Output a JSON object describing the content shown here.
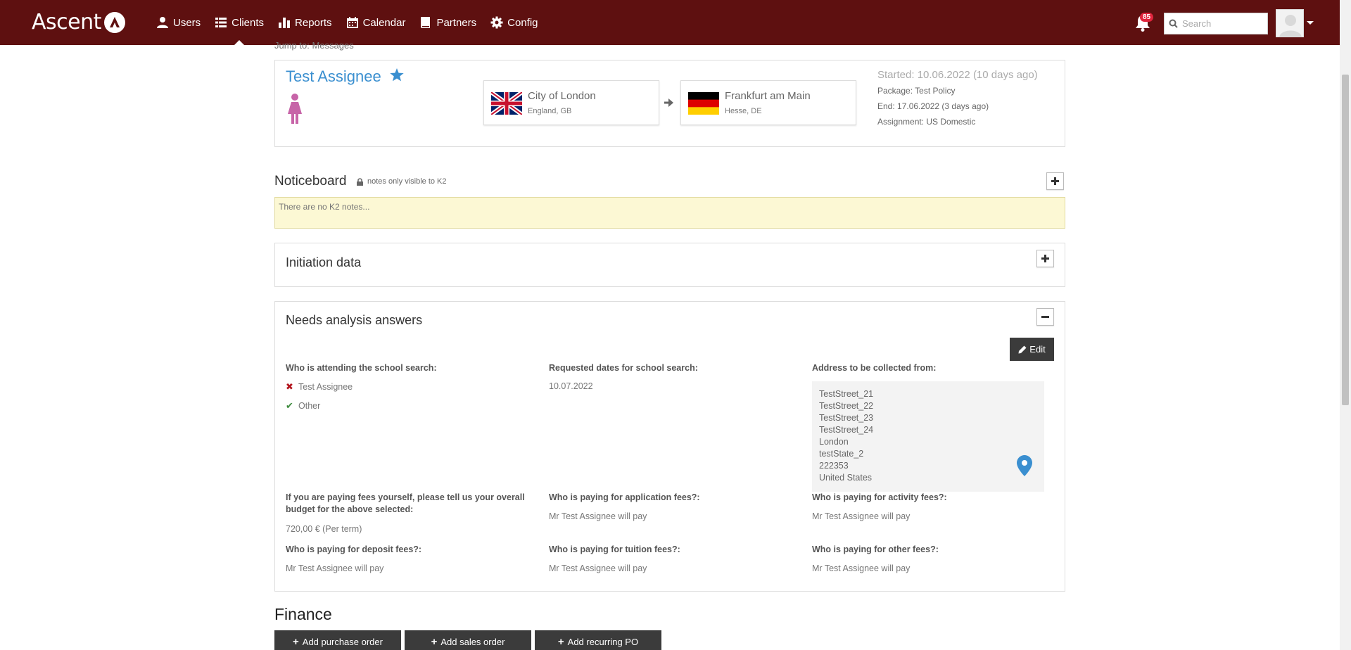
{
  "app": {
    "logo_text": "Ascent"
  },
  "nav": {
    "items": [
      {
        "label": "Users",
        "icon": "user-icon"
      },
      {
        "label": "Clients",
        "icon": "list-icon",
        "active": true
      },
      {
        "label": "Reports",
        "icon": "bar-chart-icon"
      },
      {
        "label": "Calendar",
        "icon": "calendar-icon"
      },
      {
        "label": "Partners",
        "icon": "book-icon"
      },
      {
        "label": "Config",
        "icon": "gear-icon"
      }
    ],
    "notification_count": "85",
    "search_placeholder": "Search"
  },
  "jump_to": "Jump to: Messages",
  "assignee": {
    "name": "Test Assignee",
    "origin": {
      "city": "City of London",
      "region": "England, GB"
    },
    "destination": {
      "city": "Frankfurt am Main",
      "region": "Hesse, DE"
    },
    "started": "Started: 10.06.2022 (10 days ago)",
    "package": "Package:  Test Policy",
    "end": "End:  17.06.2022 (3 days ago)",
    "assignment": "Assignment:  US Domestic"
  },
  "noticeboard": {
    "title": "Noticeboard",
    "visibility_note": "notes only visible to K2",
    "placeholder": "There are no K2 notes..."
  },
  "initiation": {
    "title": "Initiation data"
  },
  "needs": {
    "title": "Needs analysis answers",
    "edit_label": "Edit",
    "attending_label": "Who is attending the school search:",
    "attendees": [
      {
        "name": "Test Assignee",
        "selected": false
      },
      {
        "name": "Other",
        "selected": true
      }
    ],
    "dates_label": "Requested dates for school search:",
    "dates_value": "10.07.2022",
    "address_label": "Address to be collected from:",
    "address_lines": [
      "TestStreet_21",
      "TestStreet_22",
      "TestStreet_23",
      "TestStreet_24",
      "London",
      "testState_2",
      "222353",
      "United States"
    ],
    "budget_label": "If you are paying fees yourself, please tell us your overall budget for the above selected:",
    "budget_value": "720,00 € (Per term)",
    "application_label": "Who is paying for application fees?:",
    "application_value": "Mr Test Assignee will pay",
    "activity_label": "Who is paying for activity fees?:",
    "activity_value": "Mr Test Assignee will pay",
    "deposit_label": "Who is paying for deposit fees?:",
    "deposit_value": "Mr Test Assignee will pay",
    "tuition_label": "Who is paying for tuition fees?:",
    "tuition_value": "Mr Test Assignee will pay",
    "other_label": "Who is paying for other fees?:",
    "other_value": "Mr Test Assignee will pay"
  },
  "finance": {
    "title": "Finance",
    "buttons": [
      "Add purchase order",
      "Add sales order",
      "Add recurring PO"
    ]
  },
  "colors": {
    "navbar": "#5e1010",
    "link": "#3a8fd0",
    "notes_bg": "#fcf8d4",
    "badge": "#e0243c"
  }
}
